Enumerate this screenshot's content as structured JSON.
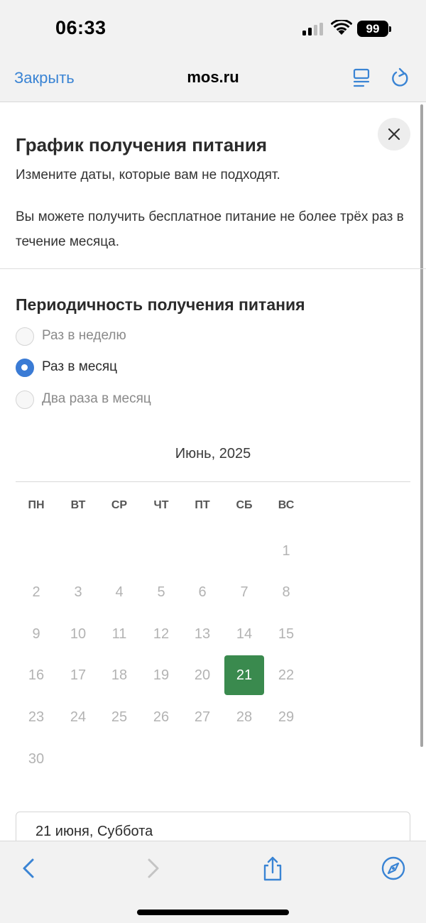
{
  "status_bar": {
    "time": "06:33",
    "battery": "99"
  },
  "browser": {
    "close_label": "Закрыть",
    "site": "mos.ru"
  },
  "modal": {
    "title": "График получения питания",
    "subtitle": "Измените даты, которые вам не подходят.",
    "info": "Вы можете получить бесплатное питание не более трёх раз в течение месяца."
  },
  "frequency": {
    "title": "Периодичность получения питания",
    "options": [
      {
        "label": "Раз в неделю",
        "checked": false
      },
      {
        "label": "Раз в месяц",
        "checked": true
      },
      {
        "label": "Два раза в месяц",
        "checked": false
      }
    ]
  },
  "calendar": {
    "month": "Июнь, 2025",
    "weekdays": [
      "ПН",
      "ВТ",
      "СР",
      "ЧТ",
      "ПТ",
      "СБ",
      "ВС"
    ],
    "days": [
      "1",
      "2",
      "3",
      "4",
      "5",
      "6",
      "7",
      "8",
      "9",
      "10",
      "11",
      "12",
      "13",
      "14",
      "15",
      "16",
      "17",
      "18",
      "19",
      "20",
      "21",
      "22",
      "23",
      "24",
      "25",
      "26",
      "27",
      "28",
      "29",
      "30"
    ],
    "selected_day": "21",
    "selected_color": "#3a8a4e"
  },
  "selected_date_label": "21 июня, Суббота",
  "icons": {
    "browser": [
      "list-icon",
      "reload-icon"
    ],
    "toolbar": [
      "back-arrow-icon",
      "forward-arrow-icon",
      "share-icon",
      "compass-icon"
    ]
  },
  "colors": {
    "accent": "#3a84d4",
    "radio_checked": "#3a7bd5"
  }
}
